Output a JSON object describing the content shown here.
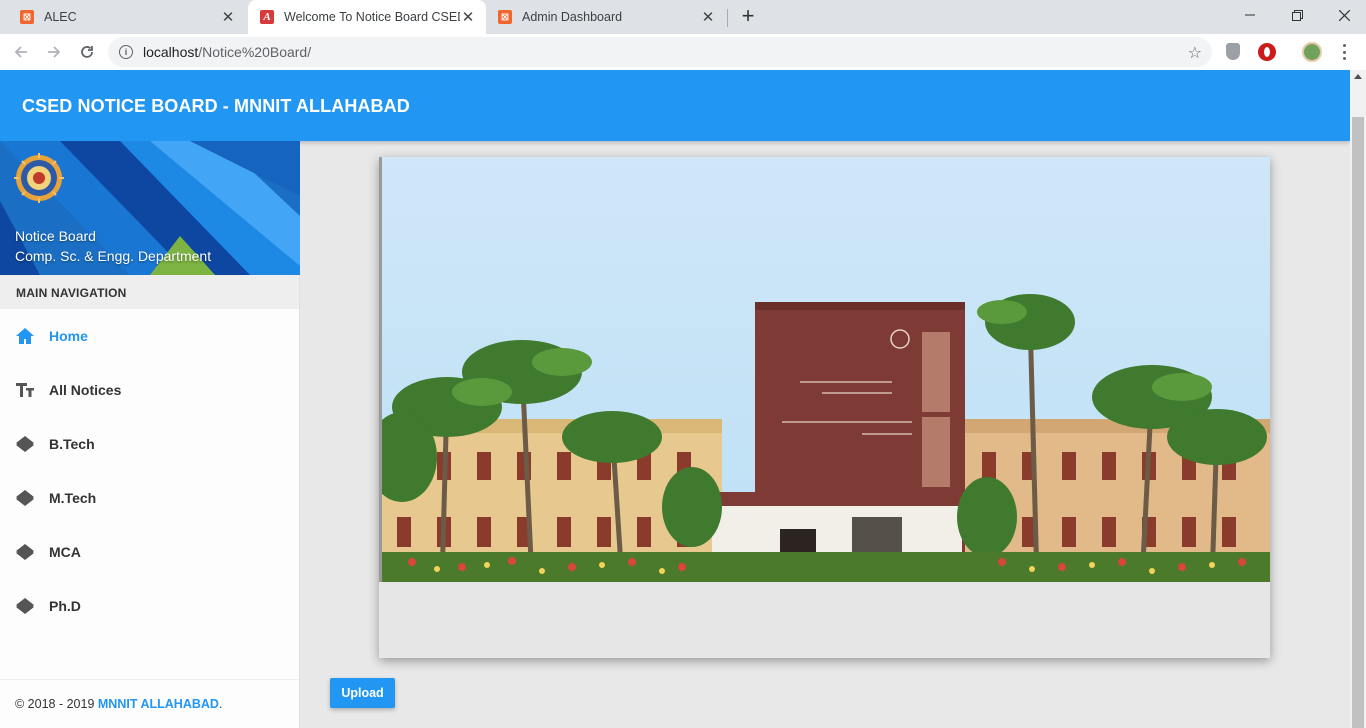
{
  "browser": {
    "tabs": [
      {
        "title": "ALEC",
        "icon": "xampp-icon"
      },
      {
        "title": "Welcome To Notice Board CSED",
        "icon": "angular-icon",
        "active": true
      },
      {
        "title": "Admin Dashboard",
        "icon": "xampp-icon"
      }
    ],
    "url_host": "localhost",
    "url_path": "/Notice%20Board/"
  },
  "header": {
    "brand": "CSED NOTICE BOARD - MNNIT ALLAHABAD"
  },
  "sidebar": {
    "user_line1": "Notice Board",
    "user_line2": "Comp. Sc. & Engg. Department",
    "nav_header": "MAIN NAVIGATION",
    "items": [
      {
        "label": "Home",
        "icon": "home-icon",
        "active": true
      },
      {
        "label": "All Notices",
        "icon": "text-fields-icon"
      },
      {
        "label": "B.Tech",
        "icon": "layers-icon"
      },
      {
        "label": "M.Tech",
        "icon": "layers-icon"
      },
      {
        "label": "MCA",
        "icon": "layers-icon"
      },
      {
        "label": "Ph.D",
        "icon": "layers-icon"
      }
    ],
    "legal_prefix": "© 2018 - 2019 ",
    "legal_link": "MNNIT ALLAHABAD",
    "legal_suffix": "."
  },
  "content": {
    "photo_alt": "MNNIT campus building",
    "upload_label": "Upload"
  },
  "colors": {
    "primary": "#2196f3",
    "sidebar_banner": "#1565c0"
  }
}
